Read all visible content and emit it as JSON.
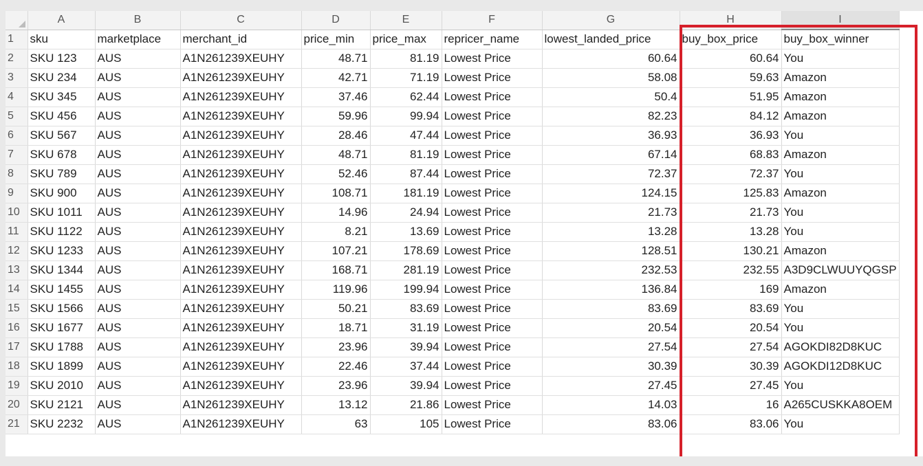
{
  "columns": [
    "A",
    "B",
    "C",
    "D",
    "E",
    "F",
    "G",
    "H",
    "I"
  ],
  "headers": [
    "sku",
    "marketplace",
    "merchant_id",
    "price_min",
    "price_max",
    "repricer_name",
    "lowest_landed_price",
    "buy_box_price",
    "buy_box_winner"
  ],
  "rows": [
    [
      "SKU 123",
      "AUS",
      "A1N261239XEUHY",
      "48.71",
      "81.19",
      "Lowest Price",
      "60.64",
      "60.64",
      "You"
    ],
    [
      "SKU 234",
      "AUS",
      "A1N261239XEUHY",
      "42.71",
      "71.19",
      "Lowest Price",
      "58.08",
      "59.63",
      "Amazon"
    ],
    [
      "SKU 345",
      "AUS",
      "A1N261239XEUHY",
      "37.46",
      "62.44",
      "Lowest Price",
      "50.4",
      "51.95",
      "Amazon"
    ],
    [
      "SKU 456",
      "AUS",
      "A1N261239XEUHY",
      "59.96",
      "99.94",
      "Lowest Price",
      "82.23",
      "84.12",
      "Amazon"
    ],
    [
      "SKU 567",
      "AUS",
      "A1N261239XEUHY",
      "28.46",
      "47.44",
      "Lowest Price",
      "36.93",
      "36.93",
      "You"
    ],
    [
      "SKU 678",
      "AUS",
      "A1N261239XEUHY",
      "48.71",
      "81.19",
      "Lowest Price",
      "67.14",
      "68.83",
      "Amazon"
    ],
    [
      "SKU 789",
      "AUS",
      "A1N261239XEUHY",
      "52.46",
      "87.44",
      "Lowest Price",
      "72.37",
      "72.37",
      "You"
    ],
    [
      "SKU 900",
      "AUS",
      "A1N261239XEUHY",
      "108.71",
      "181.19",
      "Lowest Price",
      "124.15",
      "125.83",
      "Amazon"
    ],
    [
      "SKU 1011",
      "AUS",
      "A1N261239XEUHY",
      "14.96",
      "24.94",
      "Lowest Price",
      "21.73",
      "21.73",
      "You"
    ],
    [
      "SKU 1122",
      "AUS",
      "A1N261239XEUHY",
      "8.21",
      "13.69",
      "Lowest Price",
      "13.28",
      "13.28",
      "You"
    ],
    [
      "SKU 1233",
      "AUS",
      "A1N261239XEUHY",
      "107.21",
      "178.69",
      "Lowest Price",
      "128.51",
      "130.21",
      "Amazon"
    ],
    [
      "SKU 1344",
      "AUS",
      "A1N261239XEUHY",
      "168.71",
      "281.19",
      "Lowest Price",
      "232.53",
      "232.55",
      "A3D9CLWUUYQGSP"
    ],
    [
      "SKU 1455",
      "AUS",
      "A1N261239XEUHY",
      "119.96",
      "199.94",
      "Lowest Price",
      "136.84",
      "169",
      "Amazon"
    ],
    [
      "SKU 1566",
      "AUS",
      "A1N261239XEUHY",
      "50.21",
      "83.69",
      "Lowest Price",
      "83.69",
      "83.69",
      "You"
    ],
    [
      "SKU 1677",
      "AUS",
      "A1N261239XEUHY",
      "18.71",
      "31.19",
      "Lowest Price",
      "20.54",
      "20.54",
      "You"
    ],
    [
      "SKU 1788",
      "AUS",
      "A1N261239XEUHY",
      "23.96",
      "39.94",
      "Lowest Price",
      "27.54",
      "27.54",
      "AGOKDI82D8KUC"
    ],
    [
      "SKU 1899",
      "AUS",
      "A1N261239XEUHY",
      "22.46",
      "37.44",
      "Lowest Price",
      "30.39",
      "30.39",
      "AGOKDI12D8KUC"
    ],
    [
      "SKU 2010",
      "AUS",
      "A1N261239XEUHY",
      "23.96",
      "39.94",
      "Lowest Price",
      "27.45",
      "27.45",
      "You"
    ],
    [
      "SKU 2121",
      "AUS",
      "A1N261239XEUHY",
      "13.12",
      "21.86",
      "Lowest Price",
      "14.03",
      "16",
      "A265CUSKKA8OEM"
    ],
    [
      "SKU 2232",
      "AUS",
      "A1N261239XEUHY",
      "63",
      "105",
      "Lowest Price",
      "83.06",
      "83.06",
      "You"
    ]
  ],
  "colors": {
    "highlight": "#d6202a",
    "header_bg": "#f3f3f3",
    "grid_line": "#d9d9d9"
  }
}
